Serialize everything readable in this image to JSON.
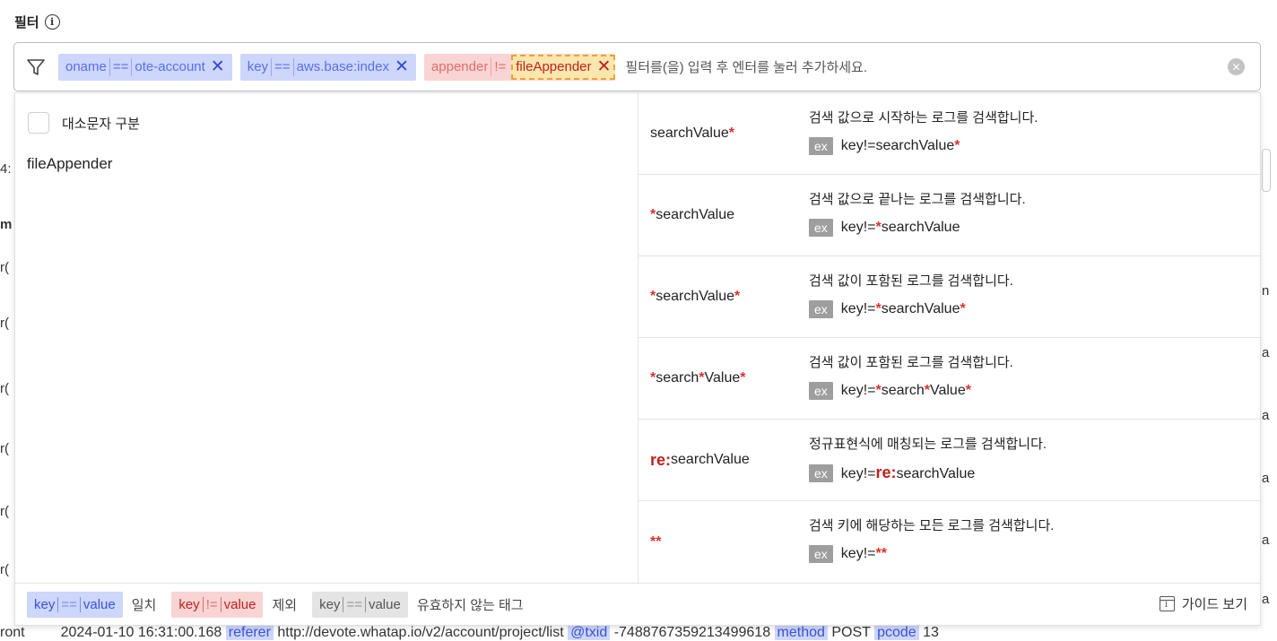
{
  "header": {
    "title": "필터",
    "info_icon": "info-circle-icon"
  },
  "filter_bar": {
    "funnel_icon": "filter-funnel-icon",
    "chips": [
      {
        "key": "oname",
        "op": "==",
        "value": "ote-account",
        "color": "#cdd6fb"
      },
      {
        "key": "key",
        "op": "==",
        "value": "aws.base:index",
        "color": "#cdd6fb"
      },
      {
        "key": "appender",
        "op": "!=",
        "value": "fileAppender",
        "color": "#f9d4d4"
      }
    ],
    "close_glyph": "✕",
    "placeholder": "필터를(을) 입력 후 엔터를 눌러 추가하세요.",
    "clear_icon": "clear-circle-icon"
  },
  "dropdown": {
    "case_label": "대소문자 구분",
    "suggestion": "fileAppender",
    "guide": [
      {
        "desc": "검색 값으로 시작하는 로그를 검색합니다.",
        "ex": "ex"
      },
      {
        "desc": "검색 값으로 끝나는 로그를 검색합니다.",
        "ex": "ex"
      },
      {
        "desc": "검색 값이 포함된 로그를 검색합니다.",
        "ex": "ex"
      },
      {
        "desc": "검색 값이 포함된 로그를 검색합니다.",
        "ex": "ex"
      },
      {
        "desc": "정규표현식에 매칭되는 로그를 검색합니다.",
        "ex": "ex"
      },
      {
        "desc": "검색 키에 해당하는 모든 로그를 검색합니다.",
        "ex": "ex"
      }
    ],
    "tokens": {
      "sv": "searchValue",
      "star": "*",
      "search": "search",
      "value": "Value",
      "re": "re:",
      "keyneq": "key!="
    },
    "legend": {
      "match": {
        "key": "key",
        "op": "==",
        "value": "value",
        "label": "일치"
      },
      "exclude": {
        "key": "key",
        "op": "!=",
        "value": "value",
        "label": "제외"
      },
      "invalid": {
        "key": "key",
        "op": "==",
        "value": "value",
        "label": "유효하지 않는 태그"
      },
      "guide_button": "가이드 보기"
    }
  },
  "background": {
    "left_fragments": [
      "4:",
      "m",
      "r(",
      "r(",
      "r(",
      "r(",
      "r(",
      "r("
    ],
    "right_fragments": [
      "n",
      "a",
      "a",
      "a",
      "a",
      "a"
    ],
    "bottom_log": {
      "prefix": "ront",
      "datetime": "2024-01-10  16:31:00.168",
      "tag1": "referer",
      "url": "http://devote.whatap.io/v2/account/project/list",
      "tag2": "@txid",
      "txid": "-7488767359213499618",
      "tag3": "method",
      "method": "POST",
      "tag4": "pcode",
      "pcode": "13"
    }
  }
}
